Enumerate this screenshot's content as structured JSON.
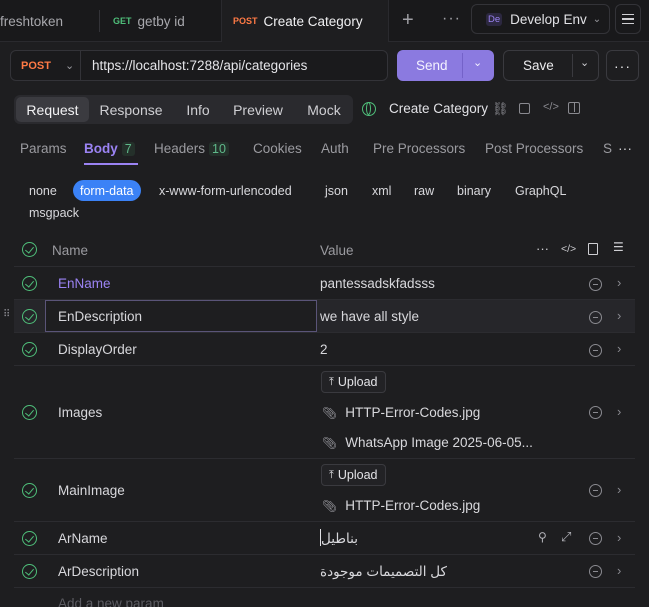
{
  "tabs": [
    {
      "method": "",
      "label": "freshtoken"
    },
    {
      "method": "GET",
      "label": "getby id"
    },
    {
      "method": "POST",
      "label": "Create Category"
    }
  ],
  "env": {
    "badge": "De",
    "label": "Develop Env"
  },
  "request": {
    "method": "POST",
    "url": "https://localhost:7288/api/categories",
    "send_label": "Send",
    "save_label": "Save",
    "name": "Create Category"
  },
  "request_tabs": [
    "Request",
    "Response",
    "Info",
    "Preview",
    "Mock"
  ],
  "sub_tabs": {
    "params": "Params",
    "body": "Body",
    "body_count": "7",
    "headers": "Headers",
    "headers_count": "10",
    "cookies": "Cookies",
    "auth": "Auth",
    "pre": "Pre Processors",
    "post": "Post Processors",
    "more": "S"
  },
  "body_types": [
    "none",
    "form-data",
    "x-www-form-urlencoded",
    "json",
    "xml",
    "raw",
    "binary",
    "GraphQL",
    "msgpack"
  ],
  "table": {
    "col_name": "Name",
    "col_value": "Value",
    "upload_label": "Upload",
    "placeholder": "Add a new param",
    "rows": [
      {
        "name": "EnName",
        "value": "pantessadskfadsss"
      },
      {
        "name": "EnDescription",
        "value": "we have all style"
      },
      {
        "name": "DisplayOrder",
        "value": "2"
      },
      {
        "name": "Images",
        "files": [
          "HTTP-Error-Codes.jpg",
          "WhatsApp Image 2025-06-05..."
        ]
      },
      {
        "name": "MainImage",
        "files": [
          "HTTP-Error-Codes.jpg"
        ]
      },
      {
        "name": "ArName",
        "value": "بناطيل"
      },
      {
        "name": "ArDescription",
        "value": "كل التصميمات موجودة"
      }
    ]
  },
  "colors": {
    "accent": "#9b83f3",
    "send": "#8b7ae0",
    "post": "#ff7a45",
    "get": "#4fbf7a",
    "formdata": "#3b82f6"
  }
}
